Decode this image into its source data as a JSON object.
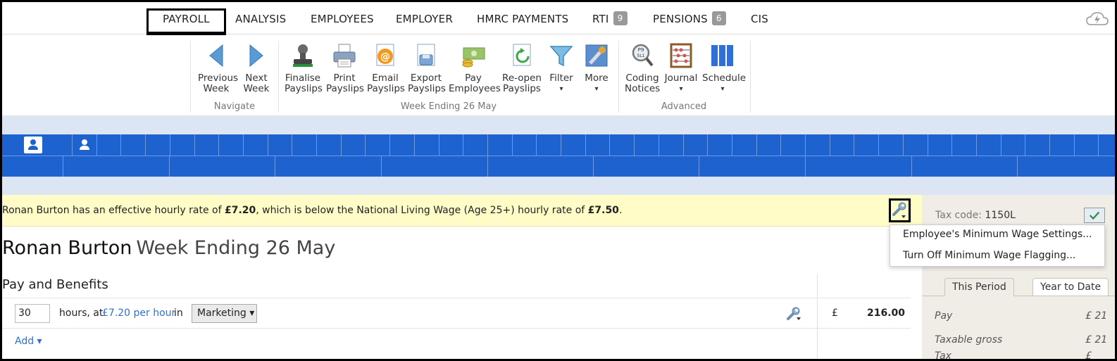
{
  "nav": {
    "items": [
      {
        "label": "PAYROLL",
        "badge": ""
      },
      {
        "label": "ANALYSIS",
        "badge": ""
      },
      {
        "label": "EMPLOYEES",
        "badge": ""
      },
      {
        "label": "EMPLOYER",
        "badge": ""
      },
      {
        "label": "HMRC PAYMENTS",
        "badge": ""
      },
      {
        "label": "RTI",
        "badge": "9"
      },
      {
        "label": "PENSIONS",
        "badge": "6"
      },
      {
        "label": "CIS",
        "badge": ""
      }
    ]
  },
  "ribbon": {
    "previous_week": [
      "Previous",
      "Week"
    ],
    "next_week": [
      "Next",
      "Week"
    ],
    "finalise_payslips": [
      "Finalise",
      "Payslips"
    ],
    "print_payslips": [
      "Print",
      "Payslips"
    ],
    "email_payslips": [
      "Email",
      "Payslips"
    ],
    "export_payslips": [
      "Export",
      "Payslips"
    ],
    "pay_employees": [
      "Pay",
      "Employees"
    ],
    "reopen_payslips": [
      "Re-open",
      "Payslips"
    ],
    "filter": "Filter",
    "more": "More",
    "coding_notices": [
      "Coding",
      "Notices"
    ],
    "journal": "Journal",
    "schedule": "Schedule",
    "dropdown_arrow": "▾",
    "group_navigate": "Navigate",
    "group_week": "Week Ending 26 May",
    "group_advanced": "Advanced"
  },
  "warning": {
    "prefix": "Ronan Burton has an effective hourly rate of ",
    "effective_rate": "£7.20",
    "middle": ", which is below the National Living Wage (Age 25+) hourly rate of ",
    "nlw_rate": "£7.50",
    "suffix": "."
  },
  "menu": {
    "item1": "Employee's Minimum Wage Settings...",
    "item2": "Turn Off Minimum Wage Flagging..."
  },
  "title": {
    "employee": "Ronan Burton",
    "week": "Week Ending 26 May"
  },
  "pay": {
    "section": "Pay and Benefits",
    "hours": "30",
    "hours_at": "hours, at",
    "rate": "£7.20 per hour",
    "in": "in",
    "department": "Marketing ▾",
    "currency": "£",
    "amount": "216.00",
    "add": "Add ▾"
  },
  "right_panel": {
    "tax_code_label": "Tax code:",
    "tax_code": "1150L",
    "tabs": [
      "This Period",
      "Year to Date"
    ],
    "rows": [
      {
        "label": "Pay",
        "value": "£ 21"
      },
      {
        "label": "Taxable gross",
        "value": "£ 21"
      },
      {
        "label": "Tax",
        "value": "£"
      }
    ]
  },
  "colors": {
    "accent_blue": "#1e62cf",
    "warning_bg": "#fffcc8",
    "link": "#2f6fd6"
  }
}
